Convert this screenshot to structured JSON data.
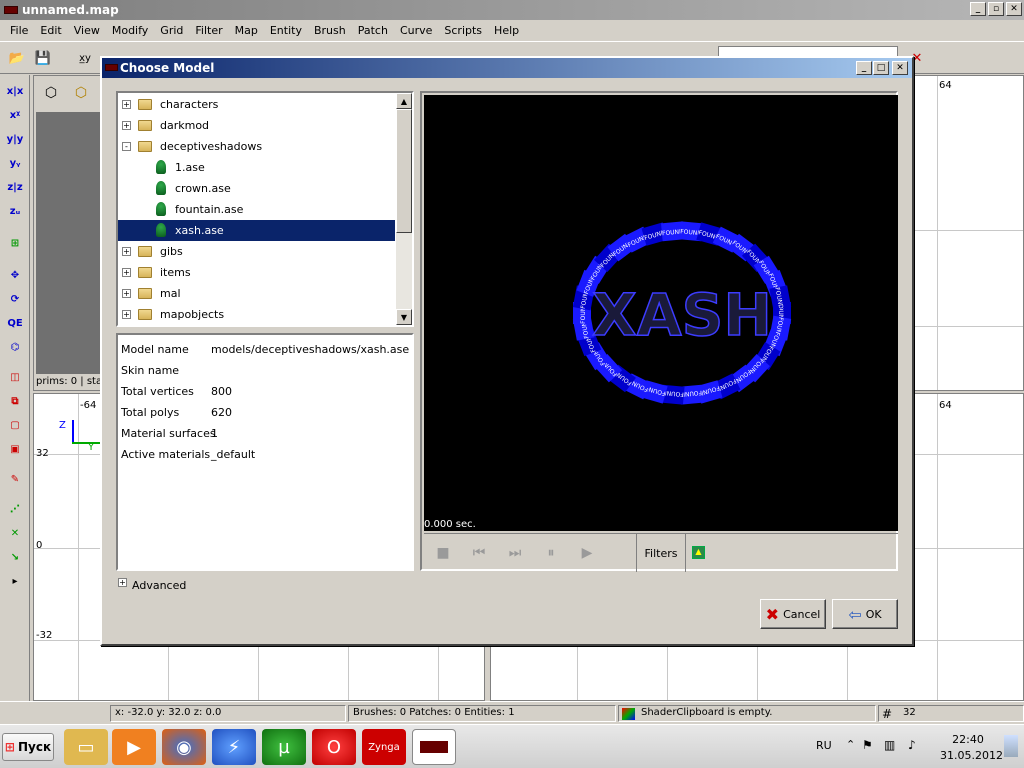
{
  "window": {
    "title": "unnamed.map"
  },
  "menu": [
    "File",
    "Edit",
    "View",
    "Modify",
    "Grid",
    "Filter",
    "Map",
    "Entity",
    "Brush",
    "Patch",
    "Curve",
    "Scripts",
    "Help"
  ],
  "viewports": {
    "top_right_label": "64",
    "bottom_right_label": "64",
    "left_labels": {
      "n64": "-64",
      "p32": "32",
      "zero": "0",
      "n32": "-32"
    },
    "axis_z": "Z",
    "axis_y": "Y",
    "camera_status": "prims: 0 | sta"
  },
  "dialog": {
    "title": "Choose Model",
    "tree": [
      {
        "label": "characters",
        "kind": "folder",
        "expander": "+",
        "indent": 0
      },
      {
        "label": "darkmod",
        "kind": "folder",
        "expander": "+",
        "indent": 0
      },
      {
        "label": "deceptiveshadows",
        "kind": "folder",
        "expander": "-",
        "indent": 0
      },
      {
        "label": "1.ase",
        "kind": "model",
        "indent": 1
      },
      {
        "label": "crown.ase",
        "kind": "model",
        "indent": 1
      },
      {
        "label": "fountain.ase",
        "kind": "model",
        "indent": 1
      },
      {
        "label": "xash.ase",
        "kind": "model",
        "indent": 1,
        "selected": true
      },
      {
        "label": "gibs",
        "kind": "folder",
        "expander": "+",
        "indent": 0
      },
      {
        "label": "items",
        "kind": "folder",
        "expander": "+",
        "indent": 0
      },
      {
        "label": "mal",
        "kind": "folder",
        "expander": "+",
        "indent": 0
      },
      {
        "label": "mapobjects",
        "kind": "folder",
        "expander": "+",
        "indent": 0
      }
    ],
    "info": [
      {
        "key": "Model name",
        "value": "models/deceptiveshadows/xash.ase"
      },
      {
        "key": "Skin name",
        "value": ""
      },
      {
        "key": "Total vertices",
        "value": "800"
      },
      {
        "key": "Total polys",
        "value": "620"
      },
      {
        "key": "Material surfaces",
        "value": "1"
      },
      {
        "key": "Active materials",
        "value": "_default"
      }
    ],
    "preview_time": "0.000 sec.",
    "preview_text": "XASH",
    "ring_label": "FOUND",
    "filters_label": "Filters",
    "advanced_label": "Advanced",
    "cancel_label": "Cancel",
    "ok_label": "OK"
  },
  "status": {
    "coords": "x:  -32.0 y:   32.0 z:    0.0",
    "counts": "Brushes: 0 Patches: 0 Entities: 1",
    "shader": "ShaderClipboard is empty.",
    "grid": "32"
  },
  "taskbar": {
    "start_label": "Пуск",
    "lang": "RU",
    "time": "22:40",
    "date": "31.05.2012"
  },
  "colors": {
    "selection": "#0a246a",
    "ring_blue": "#1a1aff",
    "titlebar_active": "#0a246a"
  }
}
